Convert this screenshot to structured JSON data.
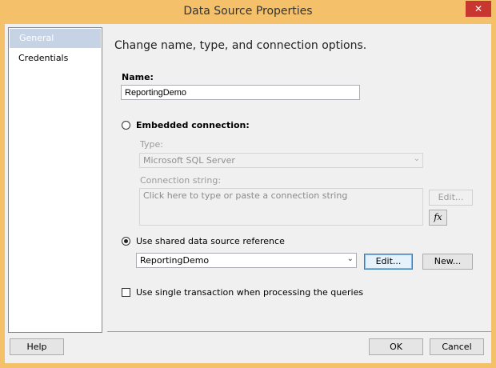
{
  "window": {
    "title": "Data Source Properties",
    "close_label": "✕"
  },
  "sidebar": {
    "items": [
      {
        "label": "General",
        "selected": true
      },
      {
        "label": "Credentials",
        "selected": false
      }
    ]
  },
  "main": {
    "heading": "Change name, type, and connection options.",
    "name_label": "Name:",
    "name_value": "ReportingDemo",
    "embedded_label": "Embedded connection:",
    "embedded_checked": false,
    "type_label": "Type:",
    "type_value": "Microsoft SQL Server",
    "conn_label": "Connection string:",
    "conn_placeholder": "Click here to type or paste a connection string",
    "conn_edit_label": "Edit...",
    "fx_label": "fx",
    "shared_label": "Use shared data source reference",
    "shared_checked": true,
    "shared_value": "ReportingDemo",
    "shared_edit_label": "Edit...",
    "shared_new_label": "New...",
    "single_tx_label": "Use single transaction when processing the queries",
    "single_tx_checked": false
  },
  "footer": {
    "help_label": "Help",
    "ok_label": "OK",
    "cancel_label": "Cancel"
  }
}
